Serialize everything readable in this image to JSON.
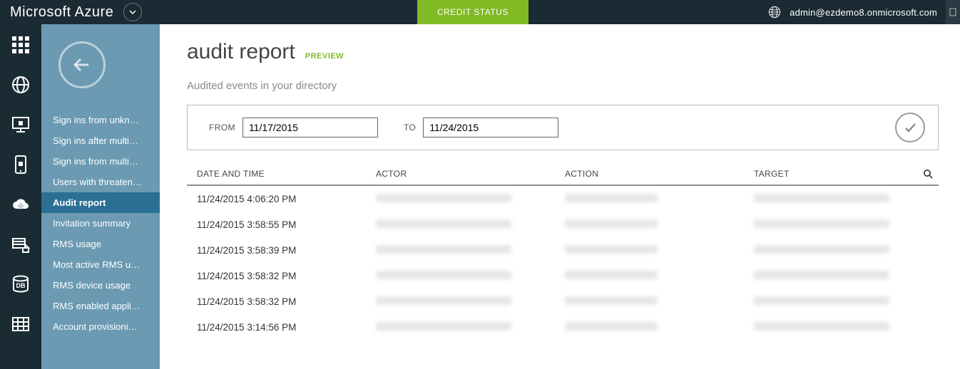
{
  "brand": "Microsoft Azure",
  "top": {
    "credit_status": "CREDIT STATUS",
    "user_email": "admin@ezdemo8.onmicrosoft.com"
  },
  "sidebar": {
    "items": [
      "Sign ins from unkn…",
      "Sign ins after multi…",
      "Sign ins from multi…",
      "Users with threaten…",
      "Audit report",
      "Invitation summary",
      "RMS usage",
      "Most active RMS u…",
      "RMS device usage",
      "RMS enabled appli…",
      "Account provisioni…"
    ],
    "active_index": 4
  },
  "page": {
    "title": "audit report",
    "preview_tag": "PREVIEW",
    "subtitle": "Audited events in your directory"
  },
  "filter": {
    "from_label": "FROM",
    "to_label": "TO",
    "from_value": "11/17/2015",
    "to_value": "11/24/2015"
  },
  "table": {
    "headers": {
      "date": "DATE AND TIME",
      "actor": "ACTOR",
      "action": "ACTION",
      "target": "TARGET"
    },
    "rows": [
      {
        "date": "11/24/2015 4:06:20 PM"
      },
      {
        "date": "11/24/2015 3:58:55 PM"
      },
      {
        "date": "11/24/2015 3:58:39 PM"
      },
      {
        "date": "11/24/2015 3:58:32 PM"
      },
      {
        "date": "11/24/2015 3:58:32 PM"
      },
      {
        "date": "11/24/2015 3:14:56 PM"
      }
    ]
  }
}
